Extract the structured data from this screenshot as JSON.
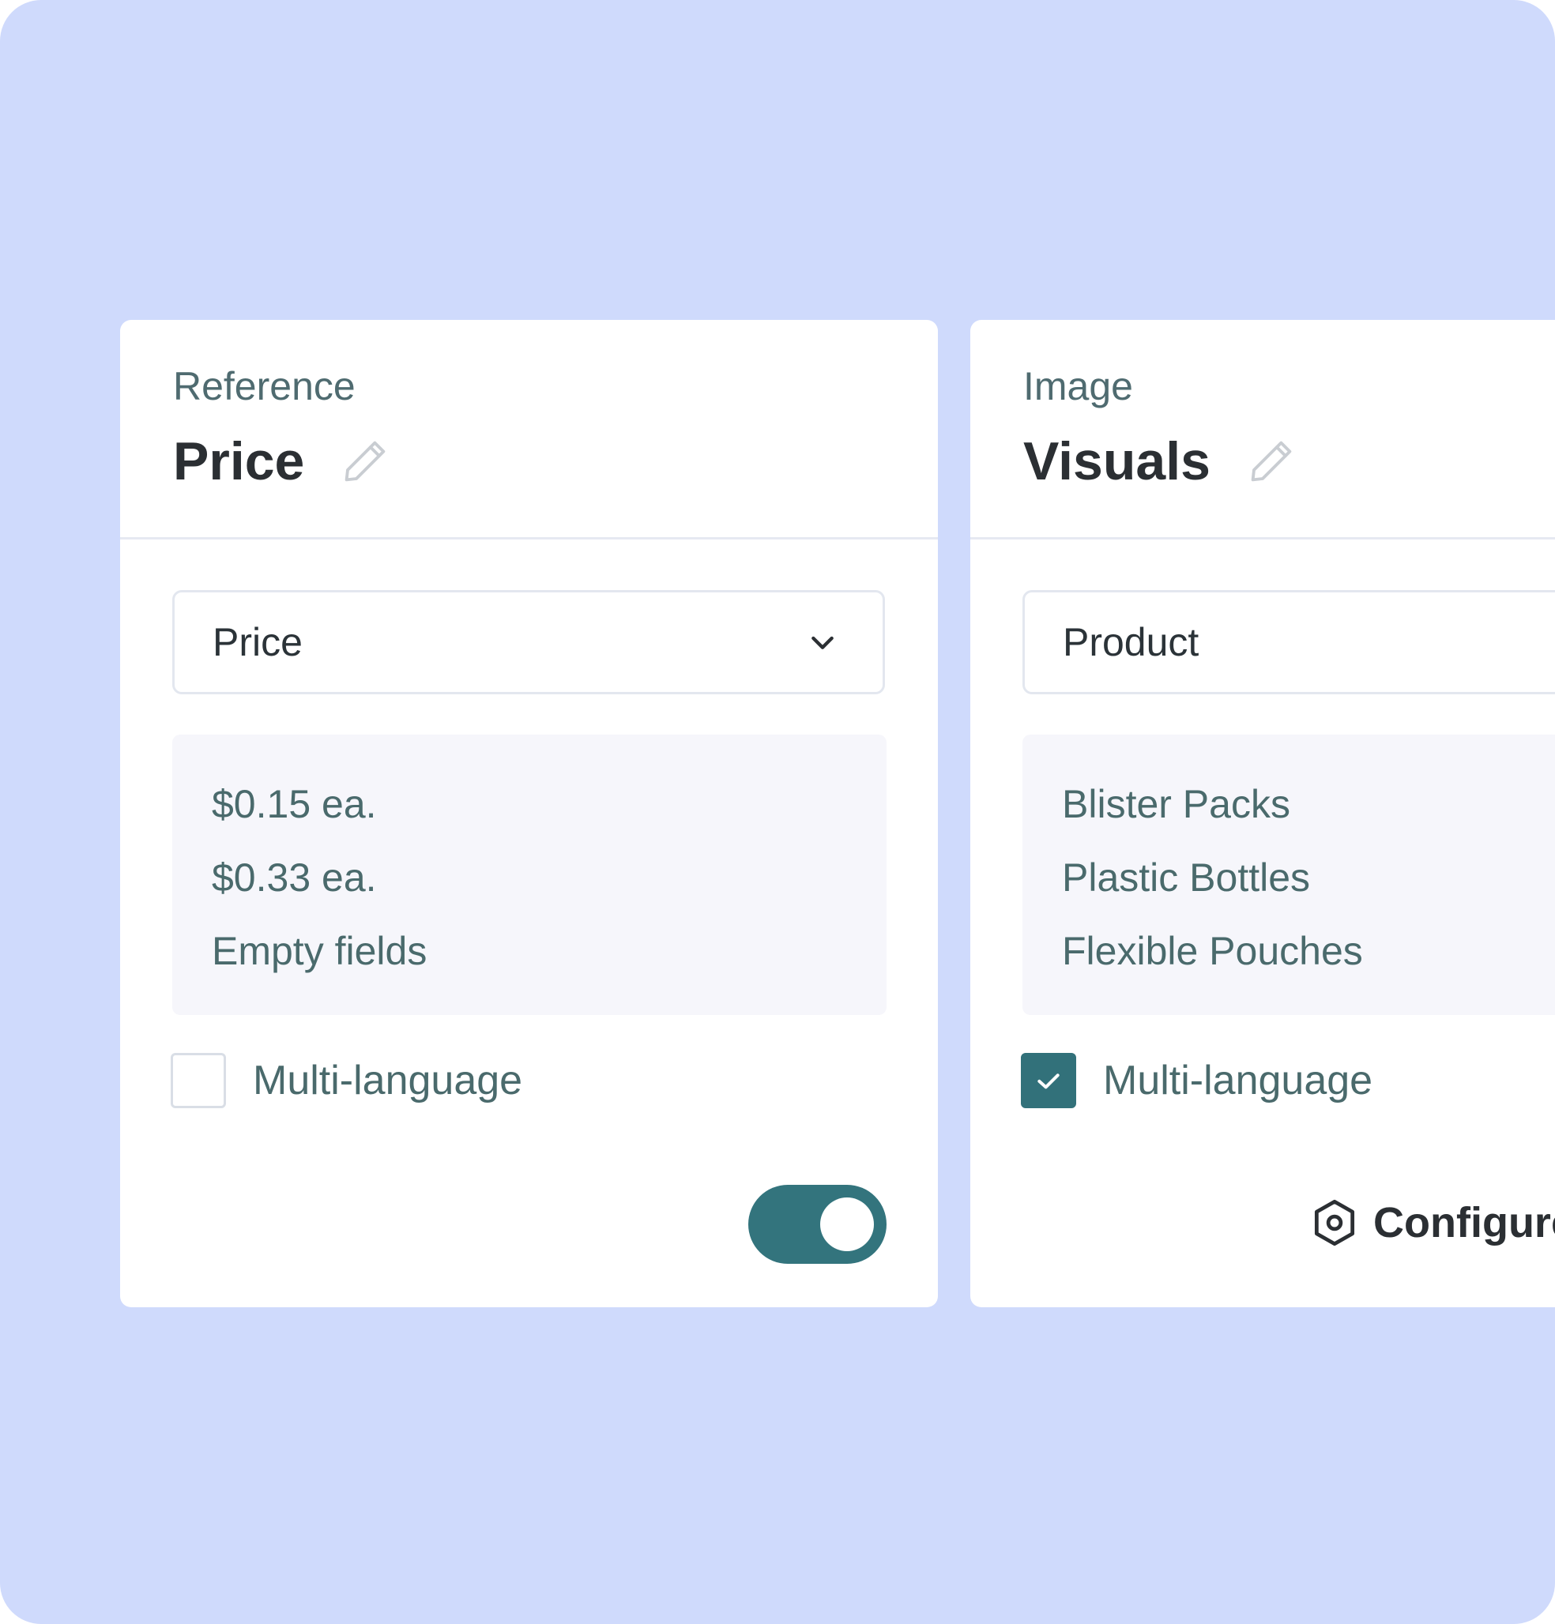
{
  "colors": {
    "background": "#cfdafc",
    "card": "#ffffff",
    "accent": "#33747d",
    "list_bg": "#f6f6fb",
    "title_text": "#2b2f33",
    "muted_text": "#4a6a6c"
  },
  "cards": [
    {
      "eyebrow": "Reference",
      "title": "Price",
      "edit_icon": "pencil-icon",
      "select": {
        "value": "Price",
        "icon": "chevron-down-icon"
      },
      "options": [
        "$0.15 ea.",
        "$0.33 ea.",
        "Empty fields"
      ],
      "multi_language": {
        "label": "Multi-language",
        "checked": false
      },
      "toggle": {
        "on": true
      }
    },
    {
      "eyebrow": "Image",
      "title": "Visuals",
      "edit_icon": "pencil-icon",
      "select": {
        "value": "Product"
      },
      "options": [
        "Blister Packs",
        "Plastic Bottles",
        "Flexible Pouches"
      ],
      "multi_language": {
        "label": "Multi-language",
        "checked": true
      },
      "configure": {
        "label": "Configure",
        "icon": "hexagon-settings-icon"
      }
    }
  ]
}
